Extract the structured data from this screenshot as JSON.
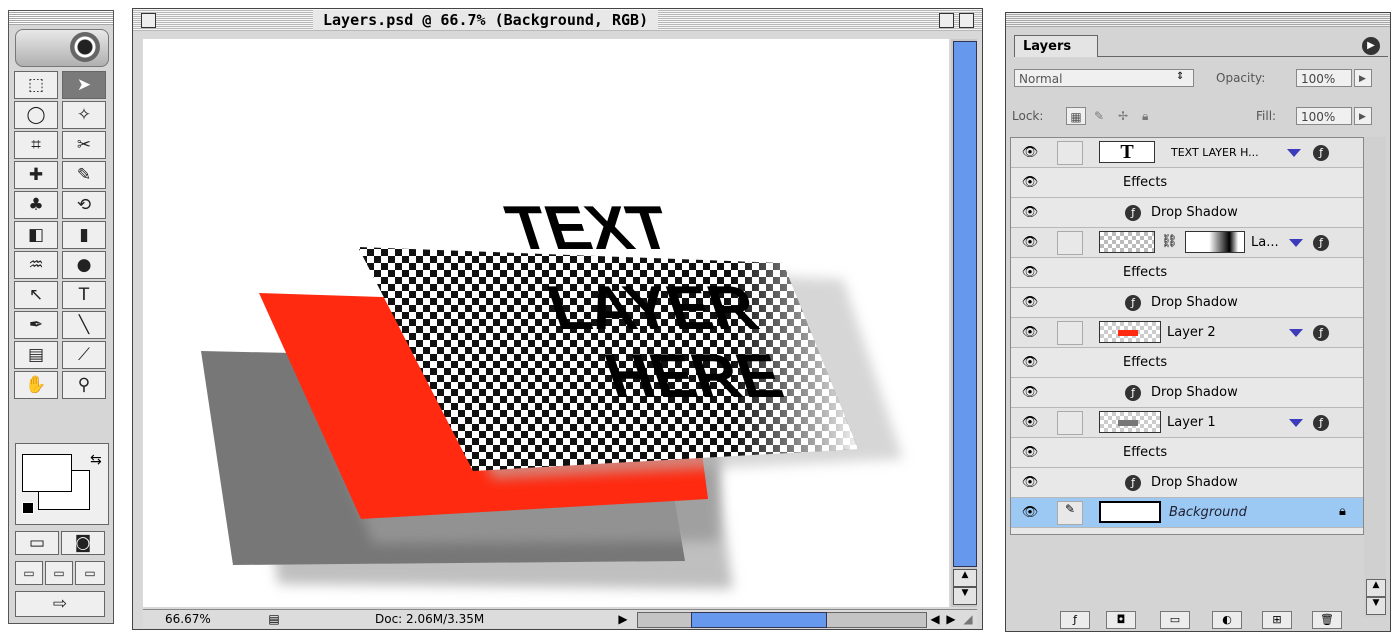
{
  "toolbox": {
    "tools": [
      {
        "name": "marquee-tool",
        "glyph": "⬚",
        "selected": false
      },
      {
        "name": "move-tool",
        "glyph": "➤",
        "selected": true
      },
      {
        "name": "lasso-tool",
        "glyph": "◯",
        "selected": false
      },
      {
        "name": "magic-wand-tool",
        "glyph": "✧",
        "selected": false
      },
      {
        "name": "crop-tool",
        "glyph": "⌗",
        "selected": false
      },
      {
        "name": "slice-tool",
        "glyph": "✂",
        "selected": false
      },
      {
        "name": "healing-brush-tool",
        "glyph": "✚",
        "selected": false
      },
      {
        "name": "brush-tool",
        "glyph": "✎",
        "selected": false
      },
      {
        "name": "clone-stamp-tool",
        "glyph": "♣",
        "selected": false
      },
      {
        "name": "history-brush-tool",
        "glyph": "⟲",
        "selected": false
      },
      {
        "name": "eraser-tool",
        "glyph": "◧",
        "selected": false
      },
      {
        "name": "gradient-tool",
        "glyph": "▮",
        "selected": false
      },
      {
        "name": "blur-tool",
        "glyph": "♒",
        "selected": false
      },
      {
        "name": "dodge-tool",
        "glyph": "●",
        "selected": false
      },
      {
        "name": "path-selection-tool",
        "glyph": "↖",
        "selected": false
      },
      {
        "name": "type-tool",
        "glyph": "T",
        "selected": false
      },
      {
        "name": "pen-tool",
        "glyph": "✒",
        "selected": false
      },
      {
        "name": "line-tool",
        "glyph": "╲",
        "selected": false
      },
      {
        "name": "notes-tool",
        "glyph": "▤",
        "selected": false
      },
      {
        "name": "eyedropper-tool",
        "glyph": "⟋",
        "selected": false
      },
      {
        "name": "hand-tool",
        "glyph": "✋",
        "selected": false
      },
      {
        "name": "zoom-tool",
        "glyph": "⚲",
        "selected": false
      }
    ]
  },
  "document": {
    "title": "Layers.psd @ 66.7% (Background, RGB)",
    "zoom": "66.67%",
    "doc_size": "Doc: 2.06M/3.35M",
    "canvas_text": [
      "TEXT",
      "LAYER",
      "HERE"
    ],
    "colors": {
      "red_layer": "#ff2a10",
      "gray_layer": "#777777",
      "scroll_accent": "#6699ee"
    }
  },
  "layers_panel": {
    "tab_label": "Layers",
    "blend_mode": "Normal",
    "opacity_label": "Opacity:",
    "opacity_value": "100%",
    "lock_label": "Lock:",
    "fill_label": "Fill:",
    "fill_value": "100%",
    "rows": [
      {
        "kind": "layer",
        "name": "TEXT LAYER H...",
        "thumb": "text"
      },
      {
        "kind": "effects",
        "name": "Effects"
      },
      {
        "kind": "effect",
        "name": "Drop Shadow"
      },
      {
        "kind": "layer",
        "name": "La...",
        "thumb": "checker-mask"
      },
      {
        "kind": "effects",
        "name": "Effects"
      },
      {
        "kind": "effect",
        "name": "Drop Shadow"
      },
      {
        "kind": "layer",
        "name": "Layer 2",
        "thumb": "red"
      },
      {
        "kind": "effects",
        "name": "Effects"
      },
      {
        "kind": "effect",
        "name": "Drop Shadow"
      },
      {
        "kind": "layer",
        "name": "Layer 1",
        "thumb": "gray"
      },
      {
        "kind": "effects",
        "name": "Effects"
      },
      {
        "kind": "effect",
        "name": "Drop Shadow"
      },
      {
        "kind": "background",
        "name": "Background",
        "thumb": "white"
      }
    ],
    "selected_color": "#9cc8f4"
  }
}
